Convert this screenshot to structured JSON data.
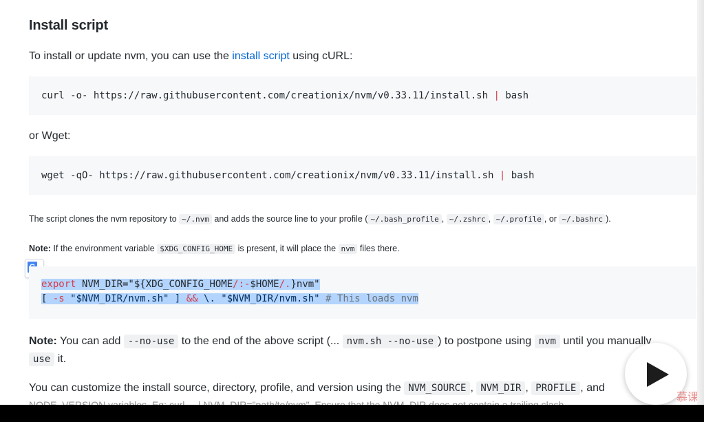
{
  "section_heading": "Install script",
  "intro": {
    "before": "To install or update nvm, you can use the ",
    "link": "install script",
    "after": " using cURL:"
  },
  "curl_block": {
    "command": "curl -o- https://raw.githubusercontent.com/creationix/nvm/v0.33.11/install.sh ",
    "pipe": "|",
    "tail": " bash"
  },
  "or_wget": "or Wget:",
  "wget_block": {
    "command": "wget -qO- https://raw.githubusercontent.com/creationix/nvm/v0.33.11/install.sh ",
    "pipe": "|",
    "tail": " bash"
  },
  "clone_note": {
    "t1": "The script clones the nvm repository to ",
    "c1": "~/.nvm",
    "t2": " and adds the source line to your profile (",
    "c2": "~/.bash_profile",
    "t3": ", ",
    "c3": "~/.zshrc",
    "t4": ", ",
    "c4": "~/.profile",
    "t5": ", or ",
    "c5": "~/.bashrc",
    "t6": ")."
  },
  "xdg_note": {
    "label": "Note:",
    "t1": " If the environment variable ",
    "c1": "$XDG_CONFIG_HOME",
    "t2": " is present, it will place the ",
    "c2": "nvm",
    "t3": " files there."
  },
  "export_block": {
    "l1_kw": "export",
    "l1_rest_a": " NVM_DIR=\"${XDG_CONFIG_HOME",
    "l1_op": "/:-",
    "l1_rest_b": "$HOME",
    "l1_op2": "/.",
    "l1_rest_c": "}nvm\"",
    "l2_a": "[ ",
    "l2_flag": "-s",
    "l2_b": " \"$NVM_DIR/nvm.sh\" ] ",
    "l2_and": "&&",
    "l2_c": " \\. \"$NVM_DIR/nvm.sh\" ",
    "l2_comment": "# This loads nvm"
  },
  "no_use_note": {
    "label": "Note:",
    "t1": " You can add ",
    "c1": "--no-use",
    "t2": " to the end of the above script (... ",
    "c2": "nvm.sh --no-use",
    "t3": ") to postpone using ",
    "c3": "nvm",
    "t4": " until you manually",
    "c4": "use",
    "t5": " it."
  },
  "customize_note": {
    "t1": "You can customize the install source, directory, profile, and version using the ",
    "c1": "NVM_SOURCE",
    "t2": ", ",
    "c2": "NVM_DIR",
    "t3": ", ",
    "c3": "PROFILE",
    "t4": ", and",
    "cut_line": "NODE_VERSION variables. Eg: curl ... | NVM_DIR=\"path/to/nvm\". Ensure that the NVM_DIR does not contain a trailing slash."
  },
  "translate_icon": {
    "g": "G",
    "t": "文"
  },
  "watermark": "慕课",
  "colors": {
    "link": "#0366d6",
    "code_bg": "#f6f8fa",
    "selection": "#b3d4fc",
    "keyword": "#d73a49"
  }
}
